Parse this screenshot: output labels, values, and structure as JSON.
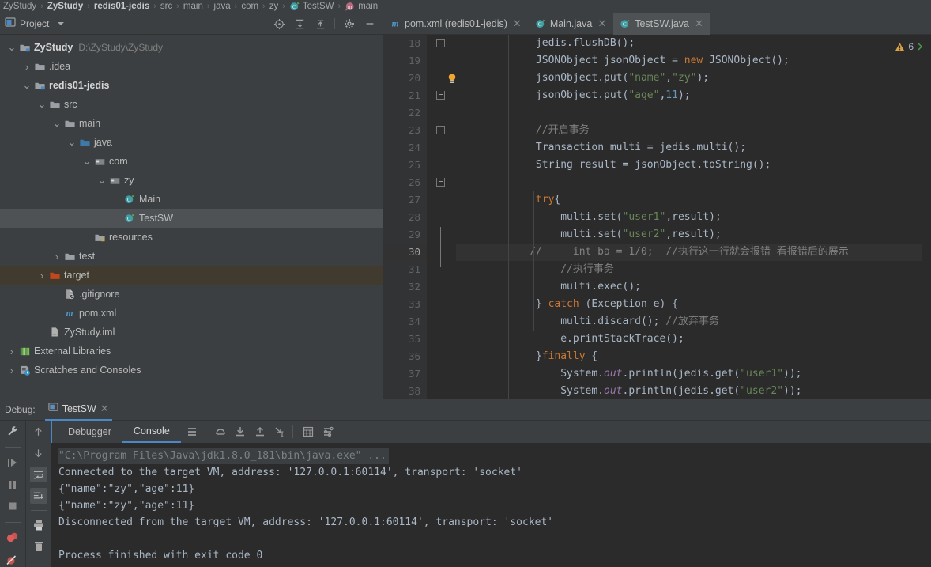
{
  "breadcrumb": {
    "items": [
      {
        "label": "ZyStudy",
        "icon": "none",
        "bold": false
      },
      {
        "label": "ZyStudy",
        "icon": "none",
        "bold": true
      },
      {
        "label": "redis01-jedis",
        "icon": "none",
        "bold": true
      },
      {
        "label": "src",
        "icon": "none",
        "bold": false
      },
      {
        "label": "main",
        "icon": "none",
        "bold": false
      },
      {
        "label": "java",
        "icon": "none",
        "bold": false
      },
      {
        "label": "com",
        "icon": "none",
        "bold": false
      },
      {
        "label": "zy",
        "icon": "none",
        "bold": false
      },
      {
        "label": "TestSW",
        "icon": "class-icon",
        "bold": false
      },
      {
        "label": "main",
        "icon": "method-icon",
        "bold": false
      }
    ]
  },
  "project_panel": {
    "title": "Project",
    "dropdown_icon": "chevron-down-icon",
    "tools": [
      {
        "name": "locate-icon"
      },
      {
        "name": "expand-all-icon"
      },
      {
        "name": "collapse-all-icon"
      },
      {
        "name": "settings-gear-icon"
      },
      {
        "name": "minimize-icon"
      }
    ],
    "tree": [
      {
        "label": "ZyStudy",
        "path": "D:\\ZyStudy\\ZyStudy",
        "depth": 0,
        "arrow": "expanded",
        "icon": "module-folder-icon",
        "bold": true,
        "state": "normal"
      },
      {
        "label": ".idea",
        "path": "",
        "depth": 1,
        "arrow": "collapsed",
        "icon": "folder-icon",
        "bold": false,
        "state": "normal"
      },
      {
        "label": "redis01-jedis",
        "path": "",
        "depth": 1,
        "arrow": "expanded",
        "icon": "module-folder-icon",
        "bold": true,
        "state": "normal"
      },
      {
        "label": "src",
        "path": "",
        "depth": 2,
        "arrow": "expanded",
        "icon": "folder-icon",
        "bold": false,
        "state": "normal"
      },
      {
        "label": "main",
        "path": "",
        "depth": 3,
        "arrow": "expanded",
        "icon": "folder-icon",
        "bold": false,
        "state": "normal"
      },
      {
        "label": "java",
        "path": "",
        "depth": 4,
        "arrow": "expanded",
        "icon": "source-folder-icon",
        "bold": false,
        "state": "normal"
      },
      {
        "label": "com",
        "path": "",
        "depth": 5,
        "arrow": "expanded",
        "icon": "package-icon",
        "bold": false,
        "state": "normal"
      },
      {
        "label": "zy",
        "path": "",
        "depth": 6,
        "arrow": "expanded",
        "icon": "package-icon",
        "bold": false,
        "state": "normal"
      },
      {
        "label": "Main",
        "path": "",
        "depth": 7,
        "arrow": "none",
        "icon": "class-icon",
        "bold": false,
        "state": "normal"
      },
      {
        "label": "TestSW",
        "path": "",
        "depth": 7,
        "arrow": "none",
        "icon": "class-icon",
        "bold": false,
        "state": "selected"
      },
      {
        "label": "resources",
        "path": "",
        "depth": 5,
        "arrow": "none",
        "icon": "resources-folder-icon",
        "bold": false,
        "state": "normal"
      },
      {
        "label": "test",
        "path": "",
        "depth": 3,
        "arrow": "collapsed",
        "icon": "folder-icon",
        "bold": false,
        "state": "normal"
      },
      {
        "label": "target",
        "path": "",
        "depth": 2,
        "arrow": "collapsed",
        "icon": "excluded-folder-icon",
        "bold": false,
        "state": "highlight"
      },
      {
        "label": ".gitignore",
        "path": "",
        "depth": 3,
        "arrow": "none",
        "icon": "gitignore-file-icon",
        "bold": false,
        "state": "normal"
      },
      {
        "label": "pom.xml",
        "path": "",
        "depth": 3,
        "arrow": "none",
        "icon": "maven-icon",
        "bold": false,
        "state": "normal"
      },
      {
        "label": "ZyStudy.iml",
        "path": "",
        "depth": 2,
        "arrow": "none",
        "icon": "iml-file-icon",
        "bold": false,
        "state": "normal"
      },
      {
        "label": "External Libraries",
        "path": "",
        "depth": 0,
        "arrow": "collapsed",
        "icon": "libraries-icon",
        "bold": false,
        "state": "normal"
      },
      {
        "label": "Scratches and Consoles",
        "path": "",
        "depth": 0,
        "arrow": "collapsed",
        "icon": "scratches-icon",
        "bold": false,
        "state": "normal"
      }
    ]
  },
  "editor": {
    "tabs": [
      {
        "label": "pom.xml (redis01-jedis)",
        "icon": "maven-icon",
        "active": false,
        "close_icon": "close-icon"
      },
      {
        "label": "Main.java",
        "icon": "class-icon",
        "active": false,
        "close_icon": "close-icon"
      },
      {
        "label": "TestSW.java",
        "icon": "class-icon",
        "active": true,
        "close_icon": "close-icon"
      }
    ],
    "warning_count": "6",
    "warning_icon": "warning-triangle-icon",
    "first_line_number": 18,
    "current_line": 30,
    "lines": [
      {
        "n": 18,
        "indent": 12,
        "tokens": [
          {
            "t": "jedis.flushDB();",
            "c": "pl"
          }
        ]
      },
      {
        "n": 19,
        "indent": 12,
        "tokens": [
          {
            "t": "JSONObject jsonObject = ",
            "c": "pl"
          },
          {
            "t": "new",
            "c": "kw"
          },
          {
            "t": " JSONObject();",
            "c": "pl"
          }
        ]
      },
      {
        "n": 20,
        "indent": 12,
        "tokens": [
          {
            "t": "jsonObject.put(",
            "c": "pl"
          },
          {
            "t": "\"name\"",
            "c": "str"
          },
          {
            "t": ",",
            "c": "pl"
          },
          {
            "t": "\"zy\"",
            "c": "str"
          },
          {
            "t": ");",
            "c": "pl"
          }
        ]
      },
      {
        "n": 21,
        "indent": 12,
        "tokens": [
          {
            "t": "jsonObject.put(",
            "c": "pl"
          },
          {
            "t": "\"age\"",
            "c": "str"
          },
          {
            "t": ",",
            "c": "pl"
          },
          {
            "t": "11",
            "c": "num"
          },
          {
            "t": ");",
            "c": "pl"
          }
        ]
      },
      {
        "n": 22,
        "indent": 0,
        "tokens": []
      },
      {
        "n": 23,
        "indent": 12,
        "tokens": [
          {
            "t": "//开启事务",
            "c": "cmt"
          }
        ]
      },
      {
        "n": 24,
        "indent": 12,
        "tokens": [
          {
            "t": "Transaction multi = jedis.multi();",
            "c": "pl"
          }
        ]
      },
      {
        "n": 25,
        "indent": 12,
        "tokens": [
          {
            "t": "String result = jsonObject.toString();",
            "c": "pl"
          }
        ]
      },
      {
        "n": 26,
        "indent": 0,
        "tokens": []
      },
      {
        "n": 27,
        "indent": 12,
        "tokens": [
          {
            "t": "try",
            "c": "kw"
          },
          {
            "t": "{",
            "c": "pl"
          }
        ]
      },
      {
        "n": 28,
        "indent": 16,
        "tokens": [
          {
            "t": "multi.set(",
            "c": "pl"
          },
          {
            "t": "\"user1\"",
            "c": "str"
          },
          {
            "t": ",result);",
            "c": "pl"
          }
        ]
      },
      {
        "n": 29,
        "indent": 16,
        "tokens": [
          {
            "t": "multi.set(",
            "c": "pl"
          },
          {
            "t": "\"user2\"",
            "c": "str"
          },
          {
            "t": ",result);",
            "c": "pl"
          }
        ]
      },
      {
        "n": 30,
        "indent": 11,
        "tokens": [
          {
            "t": "//     int ba = 1/0;  //执行这一行就会报错 看报错后的展示",
            "c": "cmt"
          }
        ]
      },
      {
        "n": 31,
        "indent": 16,
        "tokens": [
          {
            "t": "//执行事务",
            "c": "cmt"
          }
        ]
      },
      {
        "n": 32,
        "indent": 16,
        "tokens": [
          {
            "t": "multi.exec();",
            "c": "pl"
          }
        ]
      },
      {
        "n": 33,
        "indent": 12,
        "tokens": [
          {
            "t": "} ",
            "c": "pl"
          },
          {
            "t": "catch",
            "c": "kw"
          },
          {
            "t": " (Exception e) {",
            "c": "pl"
          }
        ]
      },
      {
        "n": 34,
        "indent": 16,
        "tokens": [
          {
            "t": "multi.discard(); ",
            "c": "pl"
          },
          {
            "t": "//放弃事务",
            "c": "cmt"
          }
        ]
      },
      {
        "n": 35,
        "indent": 16,
        "tokens": [
          {
            "t": "e.printStackTrace();",
            "c": "pl"
          }
        ]
      },
      {
        "n": 36,
        "indent": 12,
        "tokens": [
          {
            "t": "}",
            "c": "pl"
          },
          {
            "t": "finally",
            "c": "kw"
          },
          {
            "t": " {",
            "c": "pl"
          }
        ]
      },
      {
        "n": 37,
        "indent": 16,
        "tokens": [
          {
            "t": "System.",
            "c": "pl"
          },
          {
            "t": "out",
            "c": "fld"
          },
          {
            "t": ".println(jedis.get(",
            "c": "pl"
          },
          {
            "t": "\"user1\"",
            "c": "str"
          },
          {
            "t": "));",
            "c": "pl"
          }
        ]
      },
      {
        "n": 38,
        "indent": 16,
        "tokens": [
          {
            "t": "System.",
            "c": "pl"
          },
          {
            "t": "out",
            "c": "fld"
          },
          {
            "t": ".println(jedis.get(",
            "c": "pl"
          },
          {
            "t": "\"user2\"",
            "c": "str"
          },
          {
            "t": "));",
            "c": "pl"
          }
        ]
      }
    ]
  },
  "debug": {
    "label": "Debug:",
    "session_tab": {
      "label": "TestSW",
      "icon": "console-window-icon",
      "close_icon": "close-icon"
    },
    "side_buttons_left": [
      {
        "name": "settings-wrench-icon",
        "active": false
      },
      {
        "name": "resume-program-icon",
        "active": false
      },
      {
        "name": "pause-program-icon",
        "active": false
      },
      {
        "name": "stop-icon",
        "active": false
      },
      {
        "name": "view-breakpoints-icon",
        "active": false
      },
      {
        "name": "mute-breakpoints-icon",
        "active": false
      }
    ],
    "side_buttons_right": [
      {
        "name": "scroll-up-icon",
        "active": false
      },
      {
        "name": "scroll-down-icon",
        "active": false
      },
      {
        "name": "soft-wrap-icon",
        "active": true
      },
      {
        "name": "scroll-to-end-icon",
        "active": true
      },
      {
        "name": "print-icon",
        "active": false
      },
      {
        "name": "clear-all-icon",
        "active": false
      }
    ],
    "tabs": [
      {
        "label": "Debugger",
        "active": false
      },
      {
        "label": "Console",
        "active": true
      }
    ],
    "toolbar_icons": [
      {
        "name": "console-output-icon"
      },
      {
        "name": "step-over-icon"
      },
      {
        "name": "step-into-icon"
      },
      {
        "name": "step-out-icon"
      },
      {
        "name": "run-to-cursor-icon"
      },
      {
        "name": "evaluate-expression-icon"
      },
      {
        "name": "settings-lines-icon"
      }
    ],
    "console_lines": [
      {
        "text": "\"C:\\Program Files\\Java\\jdk1.8.0_181\\bin\\java.exe\" ...",
        "style": "cmdline"
      },
      {
        "text": "Connected to the target VM, address: '127.0.0.1:60114', transport: 'socket'",
        "style": "normal"
      },
      {
        "text": "{\"name\":\"zy\",\"age\":11}",
        "style": "normal"
      },
      {
        "text": "{\"name\":\"zy\",\"age\":11}",
        "style": "normal"
      },
      {
        "text": "Disconnected from the target VM, address: '127.0.0.1:60114', transport: 'socket'",
        "style": "normal"
      },
      {
        "text": "",
        "style": "normal"
      },
      {
        "text": "Process finished with exit code 0",
        "style": "normal"
      }
    ]
  },
  "colors": {
    "panel_bg": "#3c3f41",
    "editor_bg": "#2b2b2b",
    "gutter_bg": "#313335",
    "selection": "#4e5254",
    "highlight_row": "#413a2e",
    "accent": "#4a88c7",
    "text": "#bbbbbb",
    "code_text": "#a9b7c6",
    "keyword": "#cc7832",
    "string": "#6a8759",
    "number": "#6897bb",
    "comment": "#808080",
    "field": "#9876aa",
    "warning": "#d9a343"
  }
}
